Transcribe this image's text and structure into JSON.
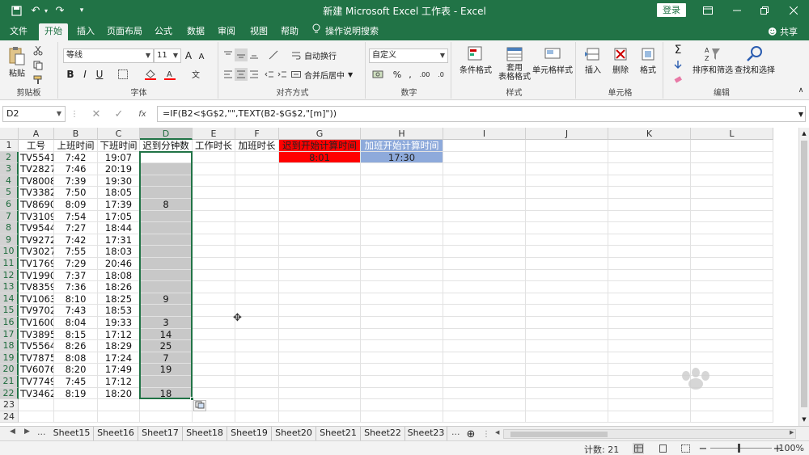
{
  "titlebar": {
    "title": "新建 Microsoft Excel 工作表 - Excel",
    "login": "登录",
    "qa_undo": "↶",
    "qa_redo": "↷",
    "qa_more": "▾"
  },
  "tabs": [
    "文件",
    "开始",
    "插入",
    "页面布局",
    "公式",
    "数据",
    "审阅",
    "视图",
    "帮助",
    "操作说明搜索"
  ],
  "share": "共享",
  "ribbon": {
    "clipboard": {
      "label": "剪贴板",
      "paste": "粘贴"
    },
    "font": {
      "label": "字体",
      "name": "等线",
      "size": "11",
      "grow": "A",
      "shrink": "A",
      "bold": "B",
      "italic": "I",
      "underline": "U"
    },
    "align": {
      "label": "对齐方式",
      "wrap": "自动换行",
      "merge": "合并后居中"
    },
    "number": {
      "label": "数字",
      "format": "自定义"
    },
    "styles": {
      "label": "样式",
      "cond": "条件格式",
      "table1": "套用",
      "table2": "表格格式",
      "cell": "单元格样式"
    },
    "cells": {
      "label": "单元格",
      "insert": "插入",
      "delete": "删除",
      "format": "格式"
    },
    "editing": {
      "label": "编辑",
      "sort": "排序和筛选",
      "find": "查找和选择"
    }
  },
  "formula": {
    "namebox": "D2",
    "fx": "fx",
    "content": "=IF(B2<$G$2,\"\",TEXT(B2-$G$2,\"[m]\"))"
  },
  "columns": [
    "A",
    "B",
    "C",
    "D",
    "E",
    "F",
    "G",
    "H",
    "I",
    "J",
    "K",
    "L"
  ],
  "header_row": {
    "A": "工号",
    "B": "上班时间",
    "C": "下班时间",
    "D": "迟到分钟数",
    "E": "工作时长",
    "F": "加班时长",
    "G": "迟到开始计算时间",
    "H": "加班开始计算时间"
  },
  "g2": "8:01",
  "h2": "17:30",
  "rows": [
    {
      "n": "2",
      "a": "TV5541",
      "b": "7:42",
      "c": "19:07",
      "d": ""
    },
    {
      "n": "3",
      "a": "TV2827",
      "b": "7:46",
      "c": "20:19",
      "d": ""
    },
    {
      "n": "4",
      "a": "TV8008",
      "b": "7:39",
      "c": "19:30",
      "d": ""
    },
    {
      "n": "5",
      "a": "TV3382",
      "b": "7:50",
      "c": "18:05",
      "d": ""
    },
    {
      "n": "6",
      "a": "TV8690",
      "b": "8:09",
      "c": "17:39",
      "d": "8"
    },
    {
      "n": "7",
      "a": "TV3109",
      "b": "7:54",
      "c": "17:05",
      "d": ""
    },
    {
      "n": "8",
      "a": "TV9544",
      "b": "7:27",
      "c": "18:44",
      "d": ""
    },
    {
      "n": "9",
      "a": "TV9272",
      "b": "7:42",
      "c": "17:31",
      "d": ""
    },
    {
      "n": "10",
      "a": "TV3027",
      "b": "7:55",
      "c": "18:03",
      "d": ""
    },
    {
      "n": "11",
      "a": "TV1769",
      "b": "7:29",
      "c": "20:46",
      "d": ""
    },
    {
      "n": "12",
      "a": "TV1990",
      "b": "7:37",
      "c": "18:08",
      "d": ""
    },
    {
      "n": "13",
      "a": "TV8359",
      "b": "7:36",
      "c": "18:26",
      "d": ""
    },
    {
      "n": "14",
      "a": "TV1063",
      "b": "8:10",
      "c": "18:25",
      "d": "9"
    },
    {
      "n": "15",
      "a": "TV9702",
      "b": "7:43",
      "c": "18:53",
      "d": ""
    },
    {
      "n": "16",
      "a": "TV1600",
      "b": "8:04",
      "c": "19:33",
      "d": "3"
    },
    {
      "n": "17",
      "a": "TV3895",
      "b": "8:15",
      "c": "17:12",
      "d": "14"
    },
    {
      "n": "18",
      "a": "TV5564",
      "b": "8:26",
      "c": "18:29",
      "d": "25"
    },
    {
      "n": "19",
      "a": "TV7875",
      "b": "8:08",
      "c": "17:24",
      "d": "7"
    },
    {
      "n": "20",
      "a": "TV6076",
      "b": "8:20",
      "c": "17:49",
      "d": "19"
    },
    {
      "n": "21",
      "a": "TV7749",
      "b": "7:45",
      "c": "17:12",
      "d": ""
    },
    {
      "n": "22",
      "a": "TV3462",
      "b": "8:19",
      "c": "18:20",
      "d": "18"
    }
  ],
  "extra_rows": [
    "1",
    "23",
    "24"
  ],
  "sheets": [
    "Sheet15",
    "Sheet16",
    "Sheet17",
    "Sheet18",
    "Sheet19",
    "Sheet20",
    "Sheet21",
    "Sheet22",
    "Sheet23"
  ],
  "sheet_more": "...",
  "status": {
    "count": "计数: 21",
    "zoom": "100%"
  },
  "colors": {
    "excel_green": "#217346",
    "g_fill": "#ff0000",
    "h_fill": "#8eaadb",
    "sel_fill": "#c8c8c8"
  }
}
